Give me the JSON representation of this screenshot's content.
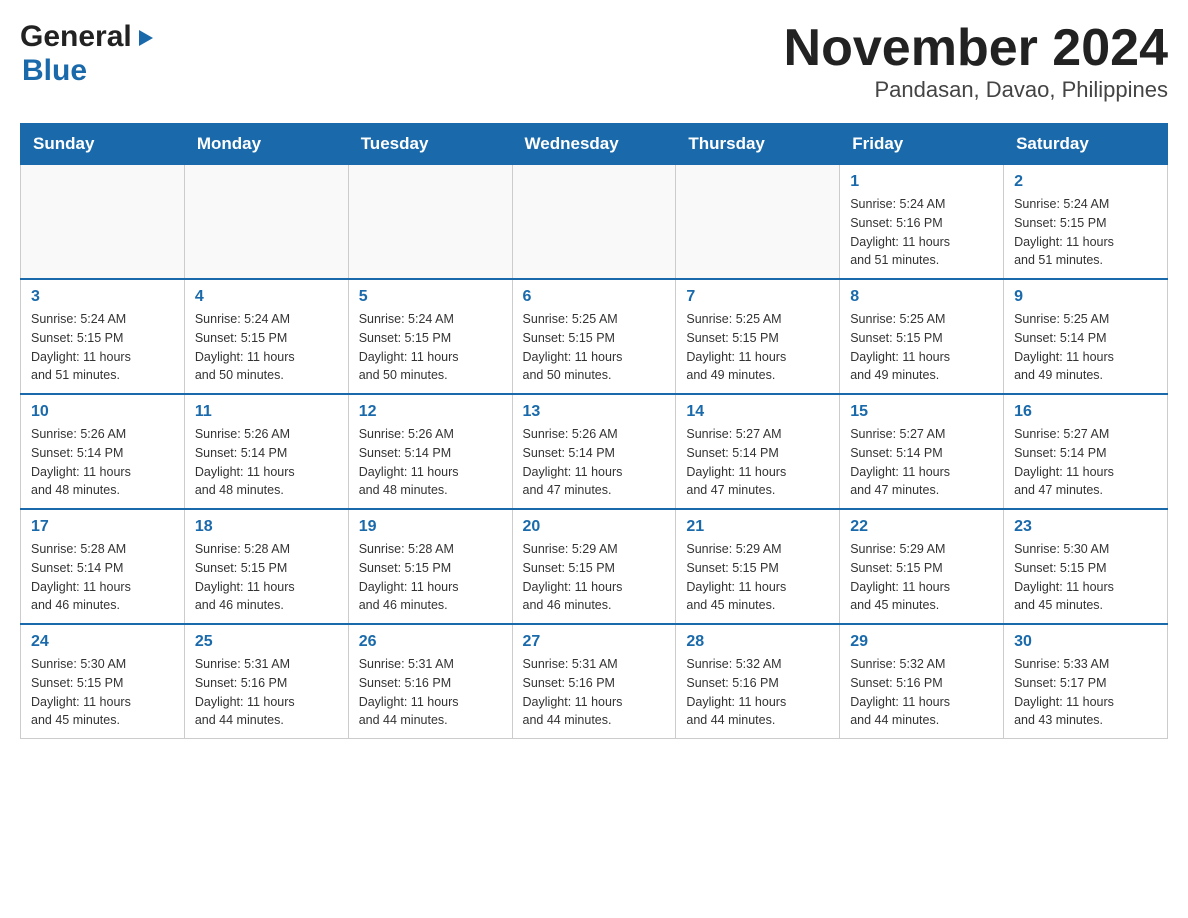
{
  "logo": {
    "general": "General",
    "blue": "Blue"
  },
  "title": "November 2024",
  "subtitle": "Pandasan, Davao, Philippines",
  "weekdays": [
    "Sunday",
    "Monday",
    "Tuesday",
    "Wednesday",
    "Thursday",
    "Friday",
    "Saturday"
  ],
  "weeks": [
    [
      {
        "day": "",
        "info": ""
      },
      {
        "day": "",
        "info": ""
      },
      {
        "day": "",
        "info": ""
      },
      {
        "day": "",
        "info": ""
      },
      {
        "day": "",
        "info": ""
      },
      {
        "day": "1",
        "info": "Sunrise: 5:24 AM\nSunset: 5:16 PM\nDaylight: 11 hours\nand 51 minutes."
      },
      {
        "day": "2",
        "info": "Sunrise: 5:24 AM\nSunset: 5:15 PM\nDaylight: 11 hours\nand 51 minutes."
      }
    ],
    [
      {
        "day": "3",
        "info": "Sunrise: 5:24 AM\nSunset: 5:15 PM\nDaylight: 11 hours\nand 51 minutes."
      },
      {
        "day": "4",
        "info": "Sunrise: 5:24 AM\nSunset: 5:15 PM\nDaylight: 11 hours\nand 50 minutes."
      },
      {
        "day": "5",
        "info": "Sunrise: 5:24 AM\nSunset: 5:15 PM\nDaylight: 11 hours\nand 50 minutes."
      },
      {
        "day": "6",
        "info": "Sunrise: 5:25 AM\nSunset: 5:15 PM\nDaylight: 11 hours\nand 50 minutes."
      },
      {
        "day": "7",
        "info": "Sunrise: 5:25 AM\nSunset: 5:15 PM\nDaylight: 11 hours\nand 49 minutes."
      },
      {
        "day": "8",
        "info": "Sunrise: 5:25 AM\nSunset: 5:15 PM\nDaylight: 11 hours\nand 49 minutes."
      },
      {
        "day": "9",
        "info": "Sunrise: 5:25 AM\nSunset: 5:14 PM\nDaylight: 11 hours\nand 49 minutes."
      }
    ],
    [
      {
        "day": "10",
        "info": "Sunrise: 5:26 AM\nSunset: 5:14 PM\nDaylight: 11 hours\nand 48 minutes."
      },
      {
        "day": "11",
        "info": "Sunrise: 5:26 AM\nSunset: 5:14 PM\nDaylight: 11 hours\nand 48 minutes."
      },
      {
        "day": "12",
        "info": "Sunrise: 5:26 AM\nSunset: 5:14 PM\nDaylight: 11 hours\nand 48 minutes."
      },
      {
        "day": "13",
        "info": "Sunrise: 5:26 AM\nSunset: 5:14 PM\nDaylight: 11 hours\nand 47 minutes."
      },
      {
        "day": "14",
        "info": "Sunrise: 5:27 AM\nSunset: 5:14 PM\nDaylight: 11 hours\nand 47 minutes."
      },
      {
        "day": "15",
        "info": "Sunrise: 5:27 AM\nSunset: 5:14 PM\nDaylight: 11 hours\nand 47 minutes."
      },
      {
        "day": "16",
        "info": "Sunrise: 5:27 AM\nSunset: 5:14 PM\nDaylight: 11 hours\nand 47 minutes."
      }
    ],
    [
      {
        "day": "17",
        "info": "Sunrise: 5:28 AM\nSunset: 5:14 PM\nDaylight: 11 hours\nand 46 minutes."
      },
      {
        "day": "18",
        "info": "Sunrise: 5:28 AM\nSunset: 5:15 PM\nDaylight: 11 hours\nand 46 minutes."
      },
      {
        "day": "19",
        "info": "Sunrise: 5:28 AM\nSunset: 5:15 PM\nDaylight: 11 hours\nand 46 minutes."
      },
      {
        "day": "20",
        "info": "Sunrise: 5:29 AM\nSunset: 5:15 PM\nDaylight: 11 hours\nand 46 minutes."
      },
      {
        "day": "21",
        "info": "Sunrise: 5:29 AM\nSunset: 5:15 PM\nDaylight: 11 hours\nand 45 minutes."
      },
      {
        "day": "22",
        "info": "Sunrise: 5:29 AM\nSunset: 5:15 PM\nDaylight: 11 hours\nand 45 minutes."
      },
      {
        "day": "23",
        "info": "Sunrise: 5:30 AM\nSunset: 5:15 PM\nDaylight: 11 hours\nand 45 minutes."
      }
    ],
    [
      {
        "day": "24",
        "info": "Sunrise: 5:30 AM\nSunset: 5:15 PM\nDaylight: 11 hours\nand 45 minutes."
      },
      {
        "day": "25",
        "info": "Sunrise: 5:31 AM\nSunset: 5:16 PM\nDaylight: 11 hours\nand 44 minutes."
      },
      {
        "day": "26",
        "info": "Sunrise: 5:31 AM\nSunset: 5:16 PM\nDaylight: 11 hours\nand 44 minutes."
      },
      {
        "day": "27",
        "info": "Sunrise: 5:31 AM\nSunset: 5:16 PM\nDaylight: 11 hours\nand 44 minutes."
      },
      {
        "day": "28",
        "info": "Sunrise: 5:32 AM\nSunset: 5:16 PM\nDaylight: 11 hours\nand 44 minutes."
      },
      {
        "day": "29",
        "info": "Sunrise: 5:32 AM\nSunset: 5:16 PM\nDaylight: 11 hours\nand 44 minutes."
      },
      {
        "day": "30",
        "info": "Sunrise: 5:33 AM\nSunset: 5:17 PM\nDaylight: 11 hours\nand 43 minutes."
      }
    ]
  ]
}
